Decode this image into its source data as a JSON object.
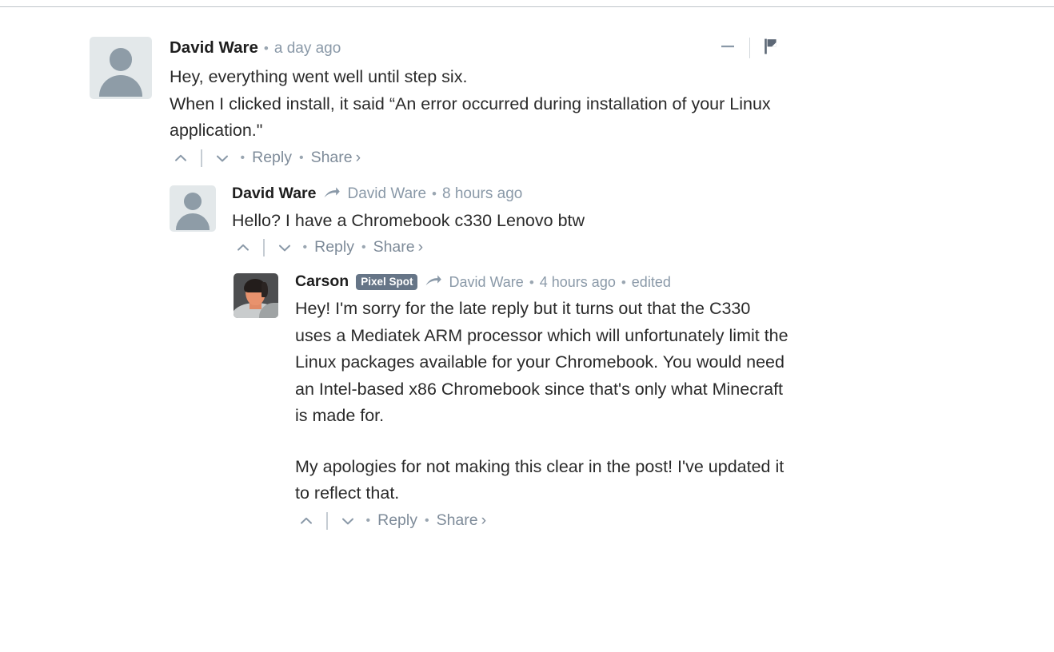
{
  "thread": {
    "comments": [
      {
        "id": "c1",
        "level": 1,
        "author": "David Ware",
        "badge": null,
        "reply_to": null,
        "timestamp": "a day ago",
        "edited": null,
        "avatar_type": "silhouette",
        "paragraphs": [
          "Hey, everything went well until step six.\nWhen I clicked install, it said “An error occurred during installation of your Linux application.\""
        ],
        "actions": {
          "upvote_icon": "chevron-up-icon",
          "downvote_icon": "chevron-down-icon",
          "reply_label": "Reply",
          "share_label": "Share",
          "share_chevron": "›",
          "dot": "•"
        },
        "header_controls": {
          "collapse_icon": "minus-icon",
          "flag_icon": "flag-icon"
        }
      },
      {
        "id": "c2",
        "level": 2,
        "author": "David Ware",
        "badge": null,
        "reply_to": "David Ware",
        "timestamp": "8 hours ago",
        "edited": null,
        "avatar_type": "silhouette",
        "paragraphs": [
          "Hello? I have a Chromebook c330 Lenovo btw"
        ],
        "actions": {
          "upvote_icon": "chevron-up-icon",
          "downvote_icon": "chevron-down-icon",
          "reply_label": "Reply",
          "share_label": "Share",
          "share_chevron": "›",
          "dot": "•"
        },
        "header_controls": null
      },
      {
        "id": "c3",
        "level": 3,
        "author": "Carson",
        "badge": "Pixel Spot",
        "reply_to": "David Ware",
        "timestamp": "4 hours ago",
        "edited": "edited",
        "avatar_type": "photo",
        "paragraphs": [
          "Hey! I'm sorry for the late reply but it turns out that the C330 uses a Mediatek ARM processor which will unfortunately limit the Linux packages available for your Chromebook. You would need an Intel-based x86 Chromebook since that's only what Minecraft is made for.",
          "My apologies for not making this clear in the post! I've updated it to reflect that."
        ],
        "actions": {
          "upvote_icon": "chevron-up-icon",
          "downvote_icon": "chevron-down-icon",
          "reply_label": "Reply",
          "share_label": "Share",
          "share_chevron": "›",
          "dot": "•"
        },
        "header_controls": null
      }
    ]
  },
  "icons": {
    "reply_arrow": "reply-arrow-icon",
    "separator_dot": "•"
  },
  "colors": {
    "author_text": "#1e1e1e",
    "body_text": "#2a2a2a",
    "meta_text": "#8a99a8",
    "link_text": "#7e8b99",
    "badge_bg": "#667587",
    "badge_text": "#ffffff",
    "avatar_bg": "#e3e8ea",
    "avatar_silhouette": "#8e9ca7",
    "divider": "#bfc4c9",
    "page_bg": "#ffffff"
  }
}
